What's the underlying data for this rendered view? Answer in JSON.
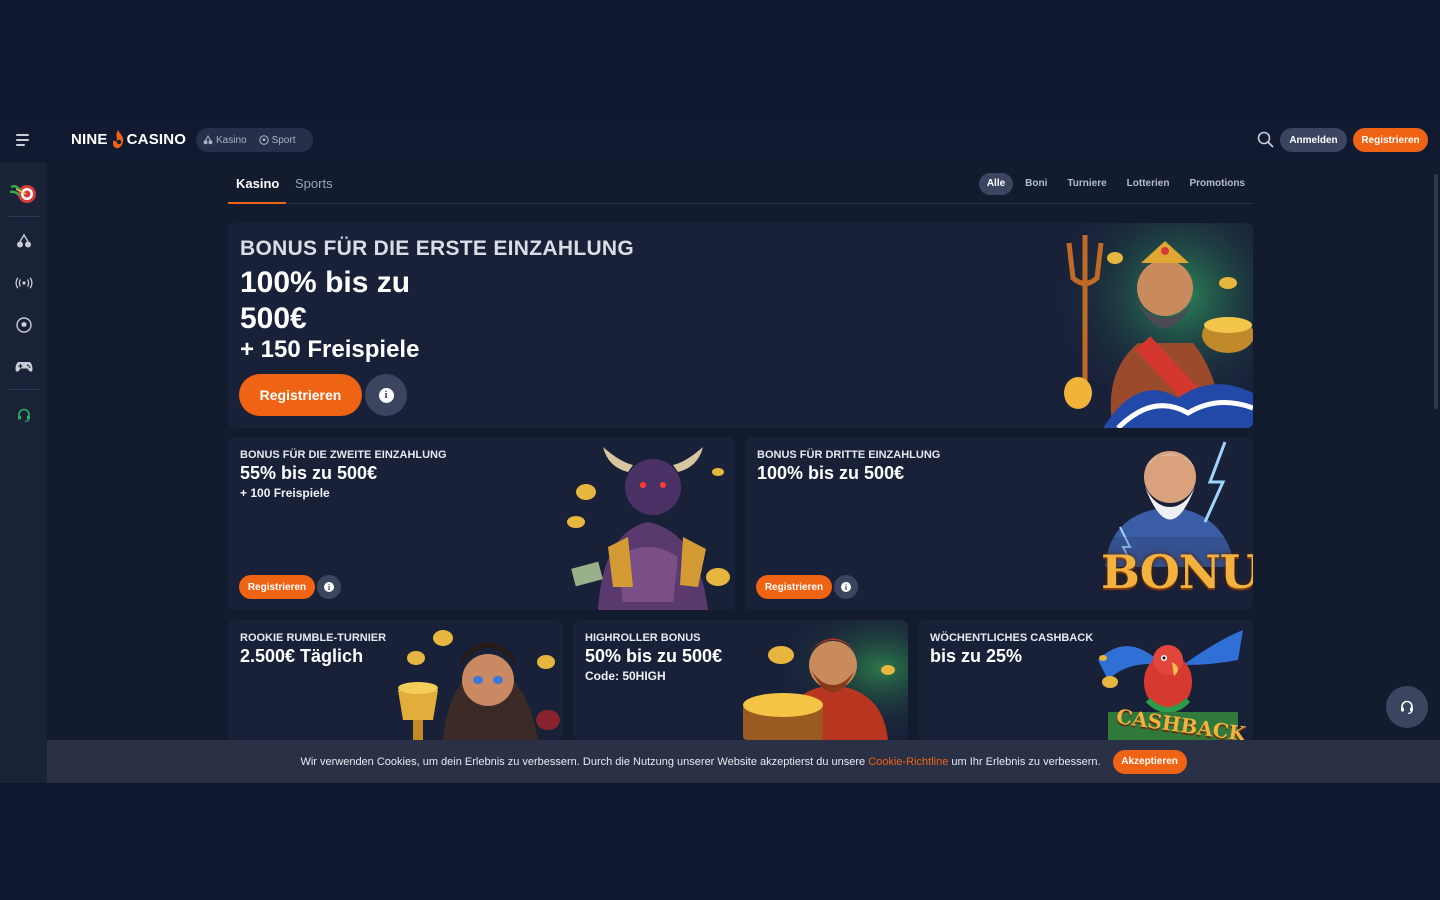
{
  "header": {
    "brand_left": "NINE",
    "brand_right": "CASINO",
    "modes": [
      {
        "label": "Kasino",
        "icon": "cherry-icon"
      },
      {
        "label": "Sport",
        "icon": "soccer-ball-icon"
      }
    ],
    "login_label": "Anmelden",
    "register_label": "Registrieren"
  },
  "sidebar": {
    "items": [
      {
        "name": "promo-icon"
      },
      {
        "name": "cherry-icon"
      },
      {
        "name": "live-broadcast-icon"
      },
      {
        "name": "soccer-ball-icon"
      },
      {
        "name": "gamepad-icon"
      },
      {
        "name": "support-headset-icon"
      }
    ]
  },
  "tabs": {
    "items": [
      "Kasino",
      "Sports"
    ],
    "filters": [
      "Alle",
      "Boni",
      "Turniere",
      "Lotterien",
      "Promotions"
    ],
    "active_filter": "Alle"
  },
  "hero": {
    "eyebrow": "BONUS FÜR DIE ERSTE EINZAHLUNG",
    "headline": "100% bis zu 500€",
    "sub": "+ 150 Freispiele",
    "cta": "Registrieren"
  },
  "cards": [
    {
      "eyebrow": "BONUS FÜR DIE ZWEITE EINZAHLUNG",
      "headline": "55% bis zu 500€",
      "sub": "+ 100 Freispiele",
      "cta": "Registrieren"
    },
    {
      "eyebrow": "BONUS FÜR DRITTE EINZAHLUNG",
      "headline": "100% bis zu 500€",
      "cta": "Registrieren",
      "art_text": "BONUS"
    },
    {
      "eyebrow": "ROOKIE RUMBLE-TURNIER",
      "headline": "2.500€ Täglich"
    },
    {
      "eyebrow": "HIGHROLLER BONUS",
      "headline": "50% bis zu 500€",
      "sub": "Code: 50HIGH"
    },
    {
      "eyebrow": "WÖCHENTLICHES CASHBACK",
      "headline": "bis zu 25%",
      "art_text": "CASHBACK"
    }
  ],
  "cookie": {
    "text_before": "Wir verwenden Cookies, um dein Erlebnis zu verbessern. Durch die Nutzung unserer Website akzeptierst du unsere ",
    "link": "Cookie-Richtline",
    "text_after": " um Ihr Erlebnis zu verbessern.",
    "accept": "Akzeptieren"
  },
  "colors": {
    "accent": "#ef6314",
    "background": "#131b2f",
    "card": "#192139"
  }
}
